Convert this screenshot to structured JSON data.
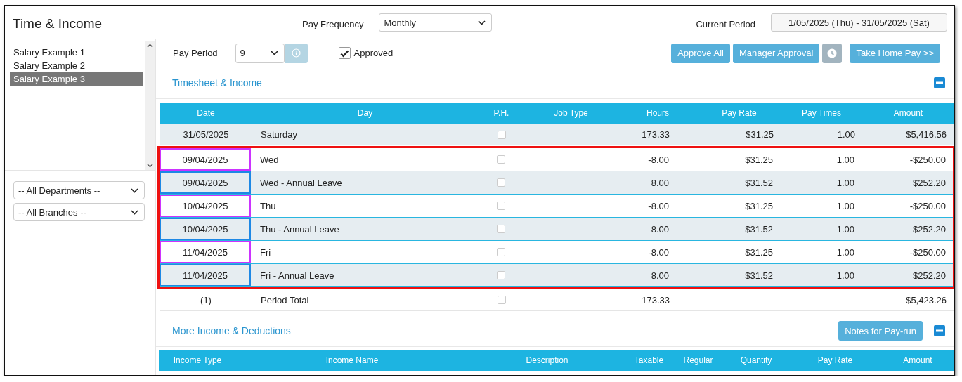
{
  "window": {
    "title": "Time & Income"
  },
  "pay_frequency": {
    "label": "Pay Frequency",
    "value": "Monthly"
  },
  "current_period": {
    "label": "Current Period",
    "value": "1/05/2025 (Thu) - 31/05/2025 (Sat)"
  },
  "employees": [
    {
      "name": "Salary Example 1",
      "selected": false
    },
    {
      "name": "Salary Example 2",
      "selected": false
    },
    {
      "name": "Salary Example 3",
      "selected": true
    }
  ],
  "filters": [
    {
      "value": "-- All Departments --"
    },
    {
      "value": "-- All Branches --"
    }
  ],
  "pay_period": {
    "label": "Pay Period",
    "value": "9"
  },
  "approved": {
    "label": "Approved",
    "checked": true
  },
  "buttons": [
    {
      "kind": "text",
      "label": "Approve All"
    },
    {
      "kind": "text",
      "label": "Manager Approval"
    },
    {
      "kind": "clock"
    },
    {
      "kind": "text",
      "label": "Take Home Pay >>"
    }
  ],
  "timesheet": {
    "title": "Timesheet & Income",
    "expanded": true,
    "columns": [
      "Date",
      "Day",
      "P.H.",
      "Job Type",
      "Hours",
      "Pay Rate",
      "Pay Times",
      "Amount"
    ],
    "rows": [
      {
        "date": "31/05/2025",
        "day": "Saturday",
        "ph": false,
        "hours": "173.33",
        "pay_rate": "$31.25",
        "pay_times": "1.00",
        "amount": "$5,416.56"
      }
    ],
    "highlighted_rows": [
      {
        "date": "09/04/2025",
        "day": "Wed",
        "ph": false,
        "hours": "-8.00",
        "pay_rate": "$31.25",
        "pay_times": "1.00",
        "amount": "-$250.00",
        "color": "#cc33ff"
      },
      {
        "date": "09/04/2025",
        "day": "Wed - Annual Leave",
        "ph": false,
        "hours": "8.00",
        "pay_rate": "$31.52",
        "pay_times": "1.00",
        "amount": "$252.20",
        "color": "#1e88e5"
      },
      {
        "date": "10/04/2025",
        "day": "Thu",
        "ph": false,
        "hours": "-8.00",
        "pay_rate": "$31.25",
        "pay_times": "1.00",
        "amount": "-$250.00",
        "color": "#cc33ff"
      },
      {
        "date": "10/04/2025",
        "day": "Thu - Annual Leave",
        "ph": false,
        "hours": "8.00",
        "pay_rate": "$31.52",
        "pay_times": "1.00",
        "amount": "$252.20",
        "color": "#1e88e5"
      },
      {
        "date": "11/04/2025",
        "day": "Fri",
        "ph": false,
        "hours": "-8.00",
        "pay_rate": "$31.25",
        "pay_times": "1.00",
        "amount": "-$250.00",
        "color": "#cc33ff"
      },
      {
        "date": "11/04/2025",
        "day": "Fri - Annual Leave",
        "ph": false,
        "hours": "8.00",
        "pay_rate": "$31.52",
        "pay_times": "1.00",
        "amount": "$252.20",
        "color": "#1e88e5"
      }
    ],
    "total": {
      "count": "(1)",
      "label": "Period Total",
      "ph": false,
      "hours": "173.33",
      "amount": "$5,423.26"
    }
  },
  "deductions": {
    "title": "More Income & Deductions",
    "expanded": true,
    "notes_button": "Notes for Pay-run",
    "columns": [
      "Income Type",
      "Income Name",
      "Description",
      "Taxable",
      "Regular",
      "Quantity",
      "Pay Rate",
      "Amount"
    ]
  }
}
